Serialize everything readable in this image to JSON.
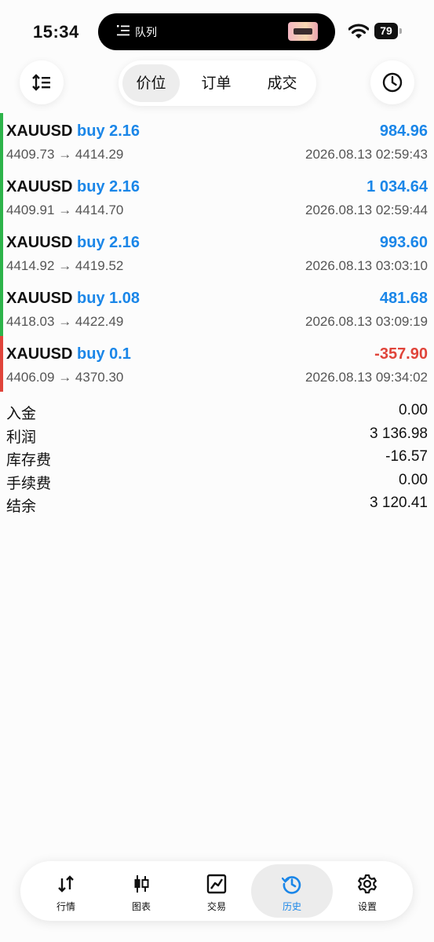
{
  "status_bar": {
    "time": "15:34",
    "island_label": "队列",
    "battery": "79"
  },
  "header": {
    "sort_icon": "sort-icon",
    "history_icon": "clock-icon",
    "tabs": [
      {
        "label": "价位",
        "active": true
      },
      {
        "label": "订单",
        "active": false
      },
      {
        "label": "成交",
        "active": false
      }
    ]
  },
  "positions": [
    {
      "symbol": "XAUUSD",
      "side": "buy 2.16",
      "profit": "984.96",
      "open_price": "4409.73",
      "close_price": "4414.29",
      "arrow": "→",
      "time": "2026.08.13 02:59:43",
      "color": "#2db34a"
    },
    {
      "symbol": "XAUUSD",
      "side": "buy 2.16",
      "profit": "1 034.64",
      "open_price": "4409.91",
      "close_price": "4414.70",
      "arrow": "→",
      "time": "2026.08.13 02:59:44",
      "color": "#2db34a"
    },
    {
      "symbol": "XAUUSD",
      "side": "buy 2.16",
      "profit": "993.60",
      "open_price": "4414.92",
      "close_price": "4419.52",
      "arrow": "→",
      "time": "2026.08.13 03:03:10",
      "color": "#2db34a"
    },
    {
      "symbol": "XAUUSD",
      "side": "buy 1.08",
      "profit": "481.68",
      "open_price": "4418.03",
      "close_price": "4422.49",
      "arrow": "→",
      "time": "2026.08.13 03:09:19",
      "color": "#2db34a"
    },
    {
      "symbol": "XAUUSD",
      "side": "buy 0.1",
      "profit": "-357.90",
      "open_price": "4406.09",
      "close_price": "4370.30",
      "arrow": "→",
      "time": "2026.08.13 09:34:02",
      "color": "#e0443a"
    }
  ],
  "summary": [
    {
      "label": "入金",
      "value": "0.00"
    },
    {
      "label": "利润",
      "value": "3 136.98"
    },
    {
      "label": "库存费",
      "value": "-16.57"
    },
    {
      "label": "手续费",
      "value": "0.00"
    },
    {
      "label": "结余",
      "value": "3 120.41"
    }
  ],
  "bottom_nav": [
    {
      "label": "行情",
      "icon": "quotes-arrows-icon",
      "active": false
    },
    {
      "label": "图表",
      "icon": "candlestick-icon",
      "active": false
    },
    {
      "label": "交易",
      "icon": "trade-chart-icon",
      "active": false
    },
    {
      "label": "历史",
      "icon": "history-clock-icon",
      "active": true
    },
    {
      "label": "设置",
      "icon": "gear-icon",
      "active": false
    }
  ],
  "colors": {
    "accent": "#1a86e8",
    "profit_positive": "#1a86e8",
    "profit_negative": "#e0443a",
    "buy_bar": "#2db34a",
    "loss_bar": "#e0443a"
  }
}
